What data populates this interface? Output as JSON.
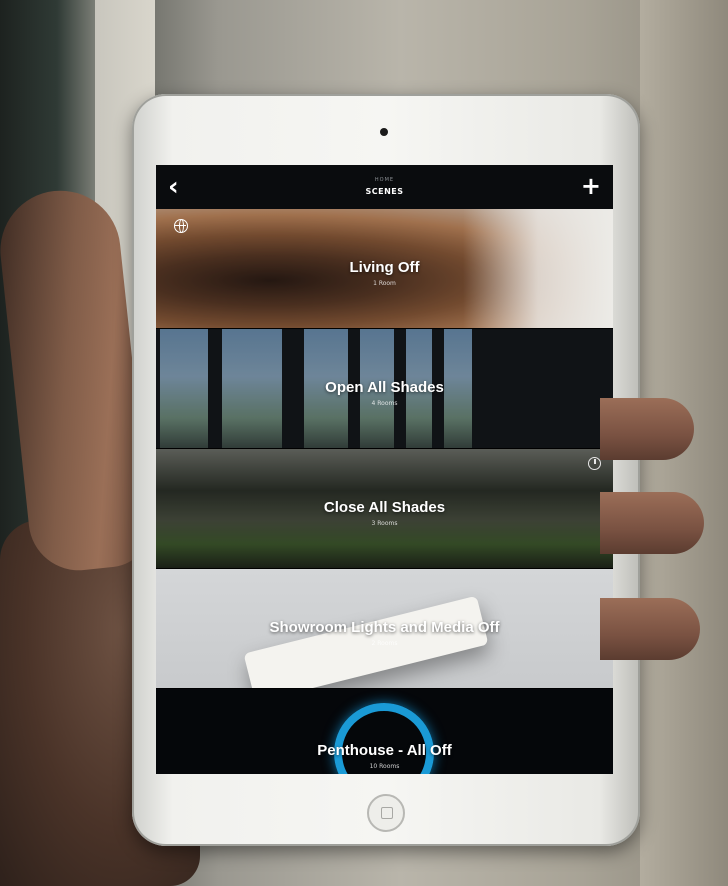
{
  "nav": {
    "back_icon": "chevron-left-icon",
    "back_glyph": "‹",
    "supertitle": "HOME",
    "title": "SCENES",
    "add_icon": "plus-icon",
    "add_glyph": "+"
  },
  "scenes": [
    {
      "name": "Living Off",
      "rooms": "1 Room",
      "badge_icon": "globe-icon"
    },
    {
      "name": "Open All Shades",
      "rooms": "4 Rooms"
    },
    {
      "name": "Close All Shades",
      "rooms": "3 Rooms",
      "badge_icon": "timer-icon"
    },
    {
      "name": "Showroom Lights and Media Off",
      "rooms": "2 Rooms"
    },
    {
      "name": "Penthouse - All Off",
      "rooms": "10 Rooms"
    }
  ],
  "colors": {
    "accent_ring": "#1a9ad6",
    "nav_background": "#0a0c0e"
  }
}
